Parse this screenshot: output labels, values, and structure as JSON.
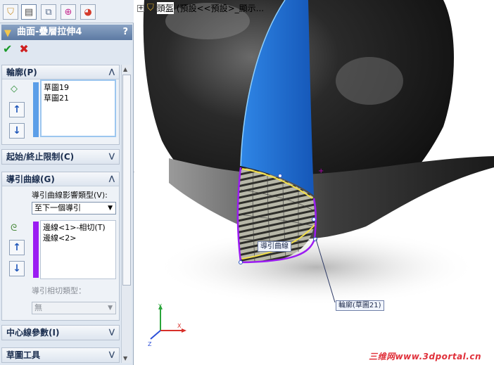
{
  "tabs": [
    {
      "icon": "feature-manager-icon"
    },
    {
      "icon": "property-manager-icon",
      "active": true
    },
    {
      "icon": "configuration-manager-icon"
    },
    {
      "icon": "dimxpert-icon"
    },
    {
      "icon": "display-manager-icon"
    }
  ],
  "property_manager": {
    "title": "曲面-疊層拉伸4",
    "help": "?"
  },
  "profiles": {
    "header": "輪廓(P)",
    "items": [
      "草圖19",
      "草圖21"
    ]
  },
  "start_end": {
    "header": "起始/終止限制(C)"
  },
  "guides": {
    "header": "導引曲線(G)",
    "influence_label": "導引曲線影響類型(V):",
    "influence_value": "至下一個導引",
    "items": [
      "邊線<1>-相切(T)",
      "邊線<2>"
    ],
    "tangency_label": "導引相切類型：",
    "tangency_value": "無"
  },
  "centerline": {
    "header": "中心線參數(I)"
  },
  "sketch_tools": {
    "header": "草圖工具"
  },
  "tree": {
    "root": "頭盔",
    "config": "(預設<<預設>_顯示..."
  },
  "callouts": {
    "guide_curve": "導引曲線",
    "profile": "輪廓(草圖21)"
  },
  "watermark": "三维网www.3dportal.cn",
  "colors": {
    "accent_blue": "#1f74d6",
    "guide_purple": "#9b1cf2",
    "ok_green": "#1a9a2a",
    "cancel_red": "#cf1f1f"
  }
}
